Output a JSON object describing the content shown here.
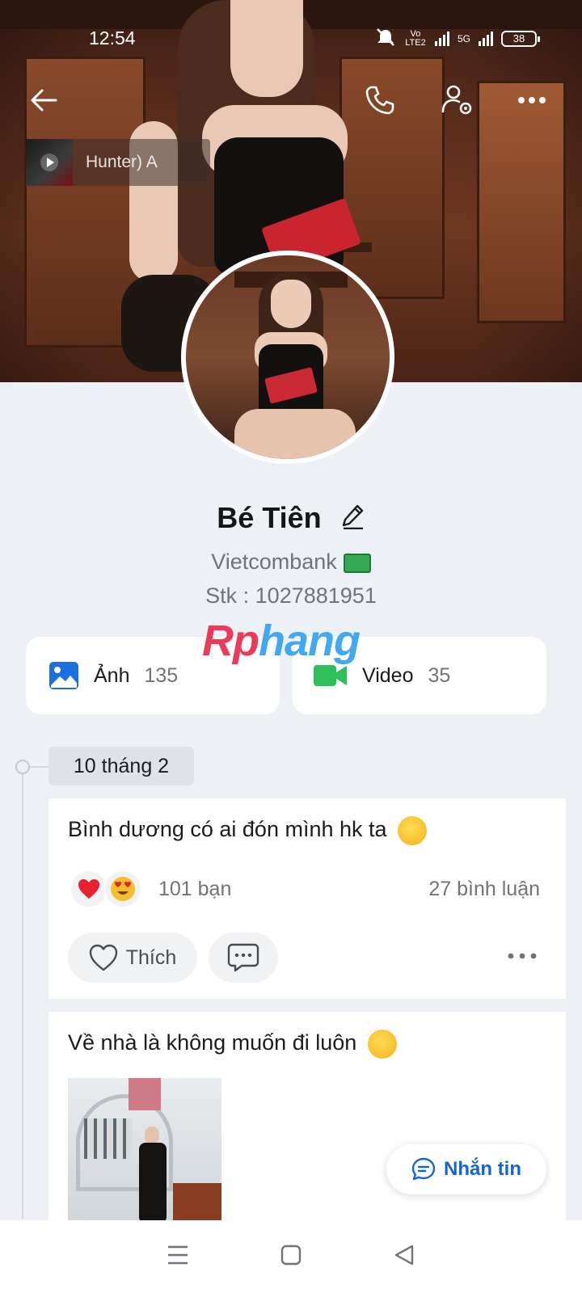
{
  "status_bar": {
    "time": "12:54",
    "network_tag": "Vo LTE2",
    "net_5g": "5G",
    "battery": "38"
  },
  "music": {
    "text": "Hunter)        A"
  },
  "profile": {
    "name": "Bé Tiên",
    "bio_line1": "Vietcombank",
    "bio_line2": "Stk : 1027881951"
  },
  "watermark": {
    "part1": "Rp",
    "part2": "hang"
  },
  "media": {
    "photos": {
      "label": "Ảnh",
      "count": "135"
    },
    "videos": {
      "label": "Video",
      "count": "35"
    }
  },
  "timeline": {
    "date": "10 tháng 2"
  },
  "posts": [
    {
      "text": "Bình dương có ai đón mình hk ta",
      "reaction_count": "101 bạn",
      "comment_count": "27 bình luận",
      "like_label": "Thích"
    },
    {
      "text": "Về nhà là không muốn đi luôn"
    }
  ],
  "chat_button": {
    "label": "Nhắn tin"
  },
  "colors": {
    "accent": "#1266d4",
    "background": "#edf0f4",
    "heart": "#e8202f"
  }
}
